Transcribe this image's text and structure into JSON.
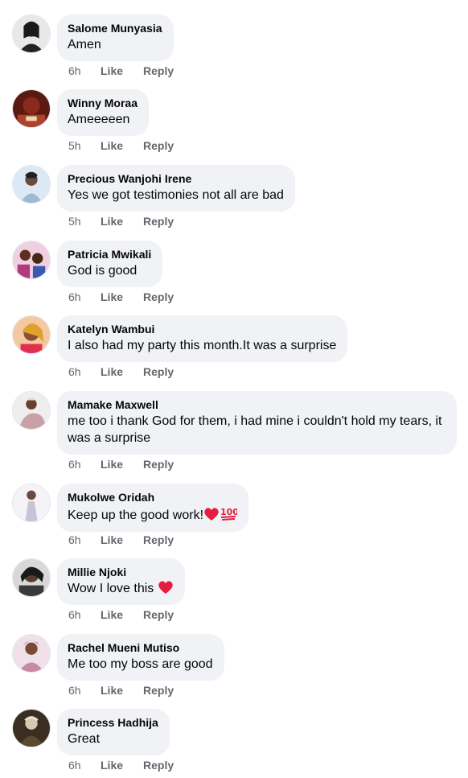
{
  "comments": [
    {
      "author": "Salome Munyasia",
      "text": "Amen",
      "time": "6h",
      "like": "Like",
      "reply": "Reply",
      "avatar_color": "#6b5a4a"
    },
    {
      "author": "Winny Moraa",
      "text": "Ameeeeen",
      "time": "5h",
      "like": "Like",
      "reply": "Reply",
      "avatar_color": "#8a2a1e"
    },
    {
      "author": "Precious Wanjohi Irene",
      "text": "Yes we got testimonies not all are bad",
      "time": "5h",
      "like": "Like",
      "reply": "Reply",
      "avatar_color": "#9fb8d8"
    },
    {
      "author": "Patricia Mwikali",
      "text": "God is good",
      "time": "6h",
      "like": "Like",
      "reply": "Reply",
      "avatar_color": "#b03a7a"
    },
    {
      "author": "Katelyn Wambui",
      "text": "I also had my party this month.It was a surprise",
      "time": "6h",
      "like": "Like",
      "reply": "Reply",
      "avatar_color": "#c96a3a"
    },
    {
      "author": "Mamake Maxwell",
      "text": "me too i thank God for them, i had mine i couldn't hold my tears, it was a surprise",
      "time": "6h",
      "like": "Like",
      "reply": "Reply",
      "avatar_color": "#c9a0a8"
    },
    {
      "author": "Mukolwe Oridah",
      "text": "Keep up the good work!",
      "emoji": [
        "red-heart",
        "hundred-points"
      ],
      "time": "6h",
      "like": "Like",
      "reply": "Reply",
      "avatar_color": "#c8c4d8"
    },
    {
      "author": "Millie Njoki",
      "text": "Wow I love this ",
      "emoji": [
        "red-heart"
      ],
      "time": "6h",
      "like": "Like",
      "reply": "Reply",
      "avatar_color": "#3a3a3a"
    },
    {
      "author": "Rachel Mueni Mutiso",
      "text": "Me too my boss are good",
      "time": "6h",
      "like": "Like",
      "reply": "Reply",
      "avatar_color": "#c88aa0"
    },
    {
      "author": "Princess Hadhija",
      "text": "Great",
      "time": "6h",
      "like": "Like",
      "reply": "Reply",
      "avatar_color": "#5a4a30"
    }
  ],
  "colors": {
    "bubble": "#f0f2f5",
    "meta_text": "#65676b",
    "heart": "#e41e3f"
  }
}
